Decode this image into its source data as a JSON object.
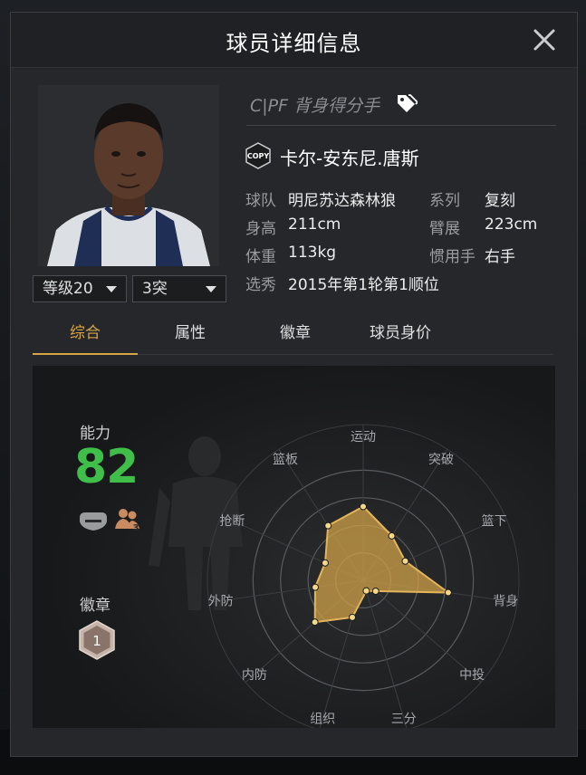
{
  "modal": {
    "title": "球员详细信息"
  },
  "player": {
    "position": "C|PF 背身得分手",
    "name": "卡尔-安东尼.唐斯",
    "info": [
      {
        "label": "球队",
        "value": "明尼苏达森林狼"
      },
      {
        "label": "系列",
        "value": "复刻"
      },
      {
        "label": "身高",
        "value": "211cm"
      },
      {
        "label": "臂展",
        "value": "223cm"
      },
      {
        "label": "体重",
        "value": "113kg"
      },
      {
        "label": "惯用手",
        "value": "右手"
      },
      {
        "label": "选秀",
        "value": "2015年第1轮第1顺位"
      }
    ],
    "copy_badge_text": "COPY"
  },
  "dropdowns": {
    "level": "等级20",
    "breakthrough": "3突"
  },
  "tabs": [
    {
      "label": "综合",
      "active": true
    },
    {
      "label": "属性",
      "active": false
    },
    {
      "label": "徽章",
      "active": false
    },
    {
      "label": "球员身价",
      "active": false
    }
  ],
  "summary": {
    "ability_label": "能力",
    "ability_value": "82",
    "breakthrough_icon_count": "3",
    "badges_label": "徽章",
    "badge_count": "1"
  },
  "radar": {
    "axes": [
      "运动",
      "突破",
      "篮下",
      "背身",
      "中投",
      "三分",
      "组织",
      "内防",
      "外防",
      "抢断",
      "篮板"
    ],
    "values": [
      0.67,
      0.48,
      0.42,
      0.78,
      0.15,
      0.1,
      0.35,
      0.58,
      0.44,
      0.38,
      0.59
    ],
    "fill_color": "#d6a548"
  },
  "colors": {
    "accent": "#d6a548",
    "ability": "#3fbf4a"
  }
}
